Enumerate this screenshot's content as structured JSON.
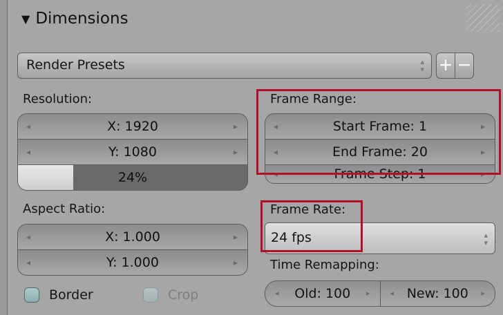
{
  "panel": {
    "title": "Dimensions",
    "collapse_glyph": "▼"
  },
  "presets": {
    "label": "Render Presets",
    "add_glyph": "+",
    "remove_glyph": "−"
  },
  "resolution": {
    "label": "Resolution:",
    "x": "X: 1920",
    "y": "Y: 1080",
    "percent_text": "24%",
    "percent": 0.24
  },
  "aspect_ratio": {
    "label": "Aspect Ratio:",
    "x": "X: 1.000",
    "y": "Y: 1.000"
  },
  "frame_range": {
    "label": "Frame Range:",
    "start": "Start Frame: 1",
    "end": "End Frame: 20",
    "step": "Frame Step: 1"
  },
  "frame_rate": {
    "label": "Frame Rate:",
    "value": "24 fps"
  },
  "time_remapping": {
    "label": "Time Remapping:",
    "old": "Old: 100",
    "new": "New: 100"
  },
  "checkboxes": {
    "border": "Border",
    "crop": "Crop"
  },
  "glyphs": {
    "left_arrow": "◂",
    "right_arrow": "▸",
    "updown": "▴▾"
  },
  "colors": {
    "highlight": "#b0102a",
    "panel_bg": "#a6a6a6"
  }
}
